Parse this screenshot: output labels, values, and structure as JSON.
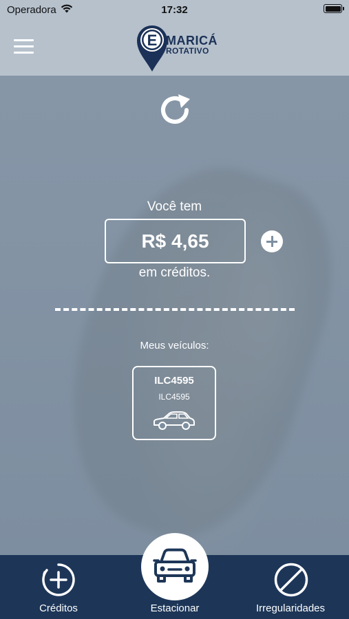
{
  "status_bar": {
    "carrier": "Operadora",
    "time": "17:32"
  },
  "header": {
    "logo_line_1": "MARICÁ",
    "logo_line_2": "ROTATIVO",
    "logo_letter": "E"
  },
  "credits": {
    "prefix": "Você tem",
    "balance": "R$ 4,65",
    "suffix": "em créditos."
  },
  "vehicles": {
    "label": "Meus veículos:",
    "items": [
      {
        "plate": "ILC4595",
        "subtitle": "ILC4595"
      }
    ]
  },
  "bottom_nav": {
    "items": [
      {
        "label": "Créditos",
        "icon": "add-credit-icon"
      },
      {
        "label": "Estacionar",
        "icon": "car-icon"
      },
      {
        "label": "Irregularidades",
        "icon": "prohibited-icon"
      }
    ]
  },
  "colors": {
    "header_bg": "#b6c1cc",
    "nav_bg": "#1d3658",
    "brand_navy": "#1b3157"
  }
}
